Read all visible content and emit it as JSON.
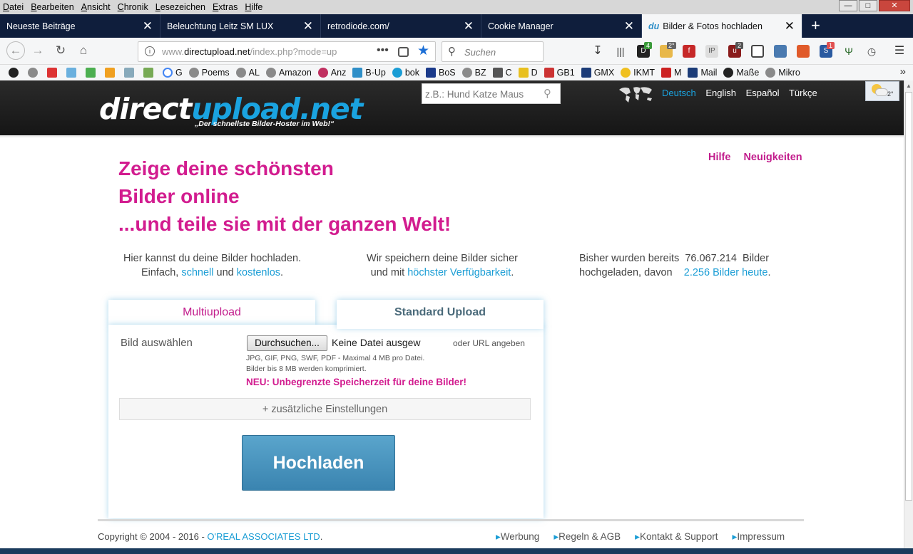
{
  "menubar": {
    "items": [
      "Datei",
      "Bearbeiten",
      "Ansicht",
      "Chronik",
      "Lesezeichen",
      "Extras",
      "Hilfe"
    ]
  },
  "tabs": [
    {
      "label": "Neueste Beiträge"
    },
    {
      "label": "Beleuchtung Leitz SM LUX"
    },
    {
      "label": "retrodiode.com/"
    },
    {
      "label": "Cookie Manager"
    },
    {
      "label": "Bilder & Fotos hochladen",
      "favicon": "du"
    }
  ],
  "urlbar": {
    "host_prefix": "www.",
    "host": "directupload.net",
    "path": "/index.php?mode=up"
  },
  "searchbar": {
    "placeholder": "Suchen"
  },
  "toolbar_badges": {
    "d_badge": "4",
    "folder_badge": "2°",
    "ublock_badge": "2",
    "s_badge": "1"
  },
  "bookmarks": [
    "G",
    "Poems",
    "AL",
    "Amazon",
    "Anz",
    "B-Up",
    "bok",
    "BoS",
    "BZ",
    "C",
    "D",
    "GB1",
    "GMX",
    "IKMT",
    "M",
    "Mail",
    "Maße",
    "Mikro"
  ],
  "site": {
    "logo_a": "direct",
    "logo_b": "upload.net",
    "tagline": "„Der schnellste Bilder-Hoster im Web!“",
    "search_placeholder": "z.B.: Hund Katze Maus",
    "languages": [
      "Deutsch",
      "English",
      "Español",
      "Türkçe"
    ],
    "weather_temp": "2°"
  },
  "toplinks": [
    "Hilfe",
    "Neuigkeiten"
  ],
  "headline": [
    "Zeige deine schönsten",
    "Bilder online",
    "...und teile sie mit der ganzen Welt!"
  ],
  "info": {
    "col1_line1": "Hier kannst du deine Bilder hochladen.",
    "col1_pre": "Einfach, ",
    "col1_link1": "schnell",
    "col1_mid": " und ",
    "col1_link2": "kostenlos",
    "col1_end": ".",
    "col2_line1": "Wir speichern deine Bilder sicher",
    "col2_pre": "und mit ",
    "col2_link": "höchster Verfügbarkeit",
    "col2_end": ".",
    "col3_line1_a": "Bisher wurden bereits",
    "col3_count": "76.067.214",
    "col3_line1_b": "Bilder",
    "col3_pre": "hochgeladen, davon",
    "col3_link": "2.256 Bilder heute",
    "col3_end": "."
  },
  "upload": {
    "tab_multi": "Multiupload",
    "tab_standard": "Standard Upload",
    "label": "Bild auswählen",
    "browse": "Durchsuchen...",
    "nofile": "Keine Datei ausgew",
    "url_link": "oder URL angeben",
    "hint1": "JPG, GIF, PNG, SWF, PDF - Maximal 4 MB pro Datei.",
    "hint2": "Bilder bis 8 MB werden komprimiert.",
    "promo": "NEU: Unbegrenzte Speicherzeit für deine Bilder!",
    "extra": "+ zusätzliche Einstellungen",
    "submit": "Hochladen"
  },
  "footer": {
    "copyright": "Copyright © 2004 - 2016 - ",
    "company": "O'REAL ASSOCIATES LTD",
    "dot": ".",
    "links": [
      "Werbung",
      "Regeln & AGB",
      "Kontakt & Support",
      "Impressum"
    ]
  }
}
